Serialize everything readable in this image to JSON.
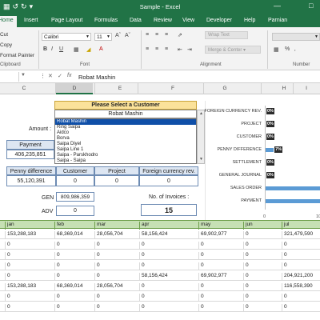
{
  "window": {
    "title": "Sample  -  Excel"
  },
  "tabs": [
    "Home",
    "Insert",
    "Page Layout",
    "Formulas",
    "Data",
    "Review",
    "View",
    "Developer",
    "Help",
    "Parnian"
  ],
  "ribbon": {
    "clipboard": {
      "cut": "Cut",
      "copy": "Copy",
      "format_painter": "Format Painter",
      "group": "Clipboard"
    },
    "font": {
      "name": "Calibri",
      "size": "11",
      "group": "Font"
    },
    "alignment": {
      "wrap": "Wrap Text",
      "merge": "Merge & Center",
      "group": "Alignment"
    },
    "number": {
      "group": "Number"
    }
  },
  "formula_bar": {
    "content": "Robat Mashin"
  },
  "columns": [
    "C",
    "D",
    "E",
    "F",
    "G",
    "H",
    "I"
  ],
  "selected_column": "D",
  "dashboard": {
    "amount_label": "Amount :",
    "payment_label": "Payment",
    "payment_value": "406,235,851",
    "select_header": "Please Select a Customer",
    "selected_customer": "Robat Mashin",
    "customers": [
      "Robat Mashin",
      "Ring Saipa",
      "Aidco",
      "Borva",
      "Saipa Diyel",
      "Saipa Line 1",
      "Saipa - Parskhodro",
      "Saipa - Saipa"
    ],
    "metrics_headers": [
      "Penny difference",
      "Customer",
      "Project",
      "Foreign currency rev."
    ],
    "metrics_values": [
      "55,120,391",
      "0",
      "0",
      "0"
    ],
    "gen_label": "GEN",
    "gen_value": "809,986,359",
    "adv_label": "ADV",
    "adv_value": "0",
    "invoices_label": "No. of Invoices :",
    "invoices_value": "15"
  },
  "chart_data": {
    "type": "bar",
    "orientation": "horizontal",
    "categories": [
      "FOREIGN CURRENCY REV.",
      "PROJECT",
      "CUSTOMER",
      "PENNY DIFFERENCE",
      "SETTLEMENT",
      "GENERAL JOURNAL",
      "SALES ORDER",
      "PAYMENT"
    ],
    "values": [
      0,
      0,
      0,
      7,
      0,
      0,
      null,
      null
    ],
    "labels": [
      "0%",
      "0%",
      "0%",
      "7%",
      "0%",
      "0%",
      "",
      ""
    ],
    "xticks": [
      "0",
      "10"
    ],
    "xlim": [
      0,
      100
    ],
    "color": "#5b9bd5"
  },
  "month_table": {
    "headers": [
      "jan",
      "feb",
      "mar",
      "apr",
      "may",
      "jun",
      "jul"
    ],
    "rows": [
      [
        "153,288,183",
        "68,369,014",
        "28,056,704",
        "58,156,424",
        "69,902,977",
        "0",
        "321,479,590"
      ],
      [
        "0",
        "0",
        "0",
        "0",
        "0",
        "0",
        "0"
      ],
      [
        "0",
        "0",
        "0",
        "0",
        "0",
        "0",
        "0"
      ],
      [
        "0",
        "0",
        "0",
        "0",
        "0",
        "0",
        "0"
      ],
      [
        "0",
        "0",
        "0",
        "58,156,424",
        "69,902,977",
        "0",
        "204,921,200"
      ],
      [
        "153,288,183",
        "68,369,014",
        "28,056,704",
        "0",
        "0",
        "0",
        "116,558,390"
      ],
      [
        "0",
        "0",
        "0",
        "0",
        "0",
        "0",
        "0"
      ],
      [
        "0",
        "0",
        "0",
        "0",
        "0",
        "0",
        "0"
      ]
    ]
  },
  "colors": {
    "excel_green": "#217346",
    "header_green": "#c6e0b4",
    "select_yellow": "#fbe29a",
    "bar_blue": "#5b9bd5"
  }
}
